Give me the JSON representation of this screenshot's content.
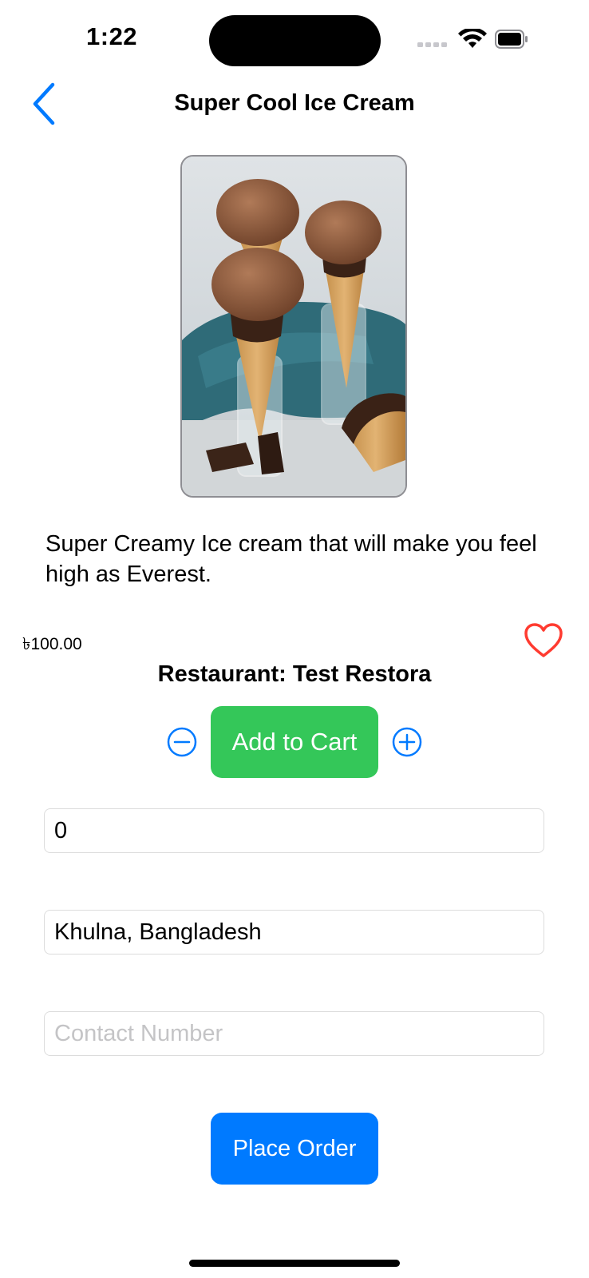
{
  "status_bar": {
    "time": "1:22"
  },
  "nav": {
    "title": "Super Cool Ice Cream",
    "back_icon": "chevron-left-icon"
  },
  "product": {
    "image_alt": "ice-cream-cones-photo",
    "description": "Super Creamy Ice cream that will make you feel high as Everest.",
    "price": "৳100.00",
    "restaurant": "Restaurant: Test Restora"
  },
  "actions": {
    "add_to_cart_label": "Add to Cart",
    "place_order_label": "Place Order"
  },
  "form": {
    "quantity_value": "0",
    "address_value": "Khulna, Bangladesh",
    "contact_placeholder": "Contact Number"
  },
  "colors": {
    "accent_blue": "#007aff",
    "add_to_cart_green": "#34c759",
    "heart_red": "#ff3b30"
  }
}
